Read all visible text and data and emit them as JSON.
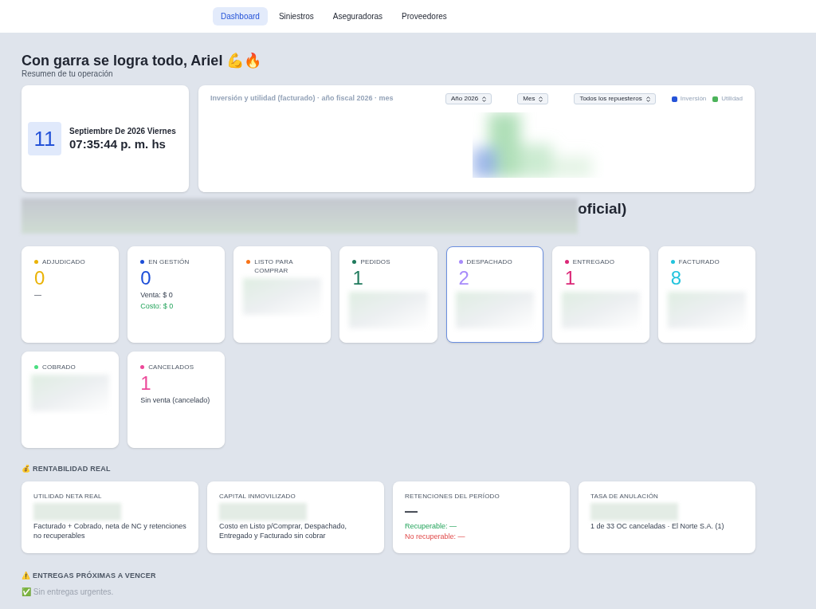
{
  "nav": {
    "tabs": [
      {
        "label": "Dashboard",
        "selected": true
      },
      {
        "label": "Siniestros",
        "selected": false
      },
      {
        "label": "Aseguradoras",
        "selected": false
      },
      {
        "label": "Proveedores",
        "selected": false
      }
    ]
  },
  "greeting": {
    "title": "Con garra se logra todo, Ariel 💪🔥",
    "subtitle": "Resumen de tu operación"
  },
  "date_card": {
    "day": "11",
    "date": "Septiembre De 2026 Viernes",
    "time": "07:35:44 p. m. hs"
  },
  "chart_panel": {
    "title": "Inversión y utilidad (facturado) · año fiscal 2026 · mes",
    "selects": [
      "Año 2026",
      "Mes",
      "Todos los repuesteros"
    ],
    "legend": [
      {
        "name": "Inversión",
        "color": "#2553d8"
      },
      {
        "name": "Utilidad",
        "color": "#4cb35a"
      }
    ]
  },
  "section_heading": {
    "text": "oficial)"
  },
  "status_cards": [
    {
      "label": "ADJUDICADO",
      "color": "#eab308",
      "selected": false,
      "value": "0",
      "lines": [
        {
          "text": "—",
          "kind": "plain"
        }
      ]
    },
    {
      "label": "EN GESTIÓN",
      "color": "#1d4ed8",
      "selected": false,
      "value": "0",
      "lines": [
        {
          "text": "Venta: $ 0",
          "kind": "plain"
        },
        {
          "text": "Costo: $ 0",
          "kind": "positive"
        }
      ]
    },
    {
      "label": "LISTO PARA COMPRAR",
      "color": "#f97316",
      "selected": false,
      "redacted": true
    },
    {
      "label": "PEDIDOS",
      "color": "#1f7a5c",
      "selected": false,
      "value": "1",
      "redacted": true
    },
    {
      "label": "DESPACHADO",
      "color": "#a78bfa",
      "selected": true,
      "value": "2",
      "redacted": true
    },
    {
      "label": "ENTREGADO",
      "color": "#db2777",
      "selected": false,
      "value": "1",
      "redacted": true
    },
    {
      "label": "FACTURADO",
      "color": "#22c3dd",
      "selected": false,
      "value": "8",
      "redacted": true
    },
    {
      "label": "COBRADO",
      "color": "#4ade80",
      "selected": false,
      "redacted": true
    },
    {
      "label": "CANCELADOS",
      "color": "#ec4899",
      "selected": false,
      "value": "1",
      "lines": [
        {
          "text": "Sin venta (cancelado)",
          "kind": "plain"
        }
      ]
    }
  ],
  "rentabilidad": {
    "heading": "💰 RENTABILIDAD REAL",
    "cards": [
      {
        "title": "UTILIDAD NETA REAL",
        "redacted": true,
        "lines": [
          {
            "text": "Facturado + Cobrado, neta de NC y retenciones no recuperables",
            "kind": "plain"
          }
        ]
      },
      {
        "title": "CAPITAL INMOVILIZADO",
        "redacted": true,
        "lines": [
          {
            "text": "Costo en Listo p/Comprar, Despachado, Entregado y Facturado sin cobrar",
            "kind": "plain"
          }
        ]
      },
      {
        "title": "RETENCIONES DEL PERÍODO",
        "value": "—",
        "lines": [
          {
            "text": "Recuperable: —",
            "kind": "positive"
          },
          {
            "text": "No recuperable: —",
            "kind": "negative"
          }
        ]
      },
      {
        "title": "TASA DE ANULACIÓN",
        "redacted": true,
        "lines": [
          {
            "text": "1 de 33 OC canceladas · El Norte S.A. (1)",
            "kind": "plain"
          }
        ]
      }
    ]
  },
  "entregas": {
    "heading": "⚠️ ENTREGAS PRÓXIMAS A VENCER",
    "message": "✅ Sin entregas urgentes."
  }
}
